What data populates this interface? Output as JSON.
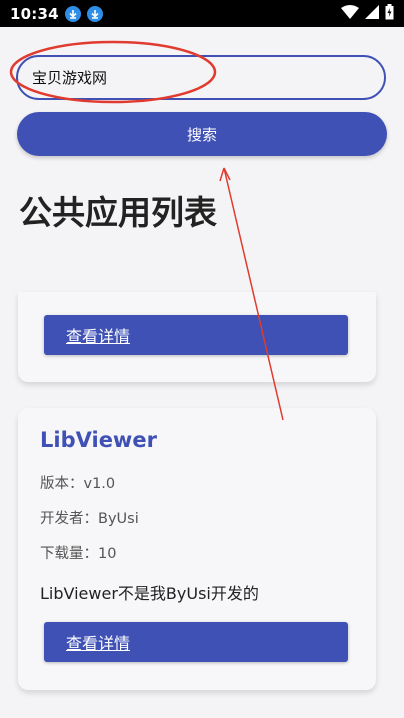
{
  "status_bar": {
    "time": "10:34",
    "download_icons": [
      "download-icon",
      "download-icon"
    ],
    "right_icons": [
      "wifi-icon",
      "signal-icon",
      "battery-icon"
    ]
  },
  "search": {
    "value": "宝贝游戏网",
    "button_label": "搜索"
  },
  "page_title": "公共应用列表",
  "apps": [
    {
      "detail_button_label": "查看详情"
    },
    {
      "name": "LibViewer",
      "version": "版本：v1.0",
      "developer": "开发者：ByUsi",
      "downloads": "下载量：10",
      "description": "LibViewer不是我ByUsi开发的",
      "detail_button_label": "查看详情"
    }
  ],
  "colors": {
    "accent": "#3f51b5",
    "annotation": "#e03b2e",
    "background": "#f4f4f7"
  }
}
